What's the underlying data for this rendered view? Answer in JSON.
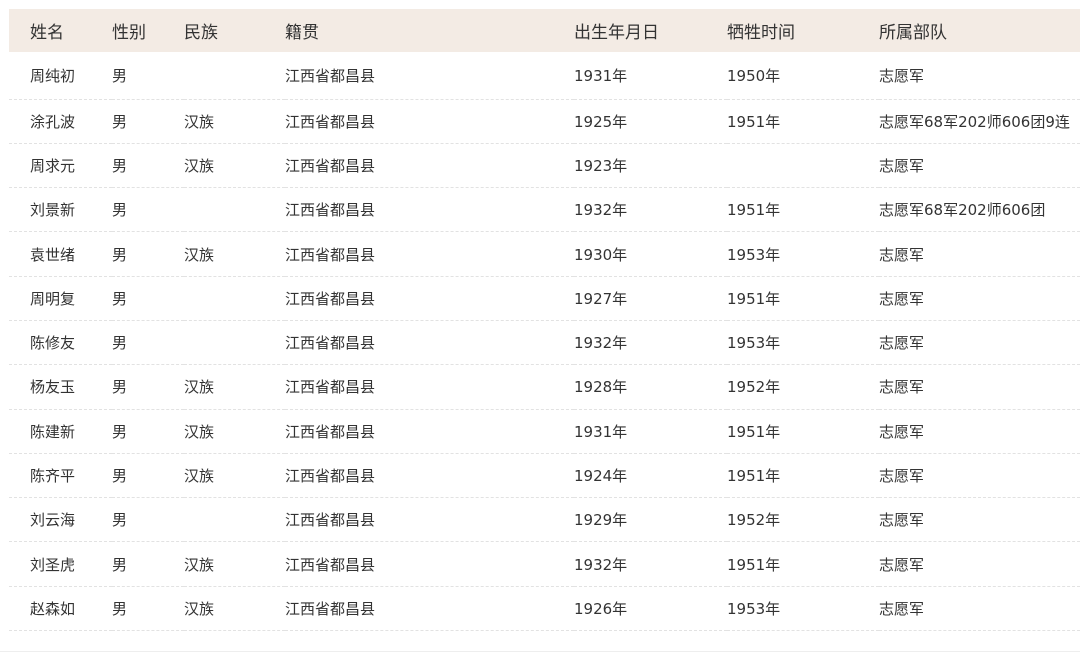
{
  "table": {
    "columns": [
      "姓名",
      "性别",
      "民族",
      "籍贯",
      "出生年月日",
      "牺牲时间",
      "所属部队"
    ],
    "rows": [
      [
        "周纯初",
        "男",
        "",
        "江西省都昌县",
        "1931年",
        "1950年",
        "志愿军"
      ],
      [
        "涂孔波",
        "男",
        "汉族",
        "江西省都昌县",
        "1925年",
        "1951年",
        "志愿军68军202师606团9连"
      ],
      [
        "周求元",
        "男",
        "汉族",
        "江西省都昌县",
        "1923年",
        "",
        "志愿军"
      ],
      [
        "刘景新",
        "男",
        "",
        "江西省都昌县",
        "1932年",
        "1951年",
        "志愿军68军202师606团"
      ],
      [
        "袁世绪",
        "男",
        "汉族",
        "江西省都昌县",
        "1930年",
        "1953年",
        "志愿军"
      ],
      [
        "周明复",
        "男",
        "",
        "江西省都昌县",
        "1927年",
        "1951年",
        "志愿军"
      ],
      [
        "陈修友",
        "男",
        "",
        "江西省都昌县",
        "1932年",
        "1953年",
        "志愿军"
      ],
      [
        "杨友玉",
        "男",
        "汉族",
        "江西省都昌县",
        "1928年",
        "1952年",
        "志愿军"
      ],
      [
        "陈建新",
        "男",
        "汉族",
        "江西省都昌县",
        "1931年",
        "1951年",
        "志愿军"
      ],
      [
        "陈齐平",
        "男",
        "汉族",
        "江西省都昌县",
        "1924年",
        "1951年",
        "志愿军"
      ],
      [
        "刘云海",
        "男",
        "",
        "江西省都昌县",
        "1929年",
        "1952年",
        "志愿军"
      ],
      [
        "刘圣虎",
        "男",
        "汉族",
        "江西省都昌县",
        "1932年",
        "1951年",
        "志愿军"
      ],
      [
        "赵森如",
        "男",
        "汉族",
        "江西省都昌县",
        "1926年",
        "1953年",
        "志愿军"
      ]
    ]
  },
  "colors": {
    "header_bg": "#f3ebe4",
    "text": "#333333",
    "row_divider": "#e2e2e2"
  }
}
